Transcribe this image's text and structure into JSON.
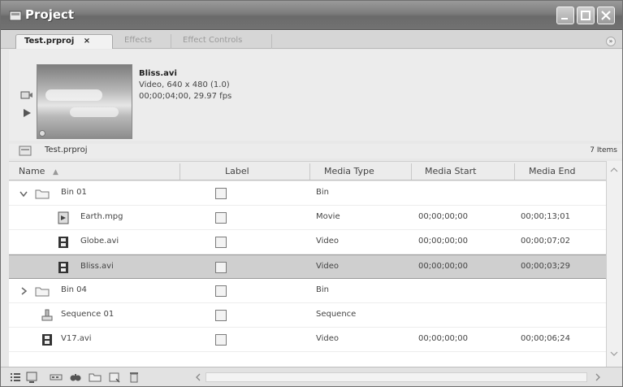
{
  "window": {
    "title": "Project"
  },
  "tabs": [
    {
      "label": "Test.prproj",
      "close": "×",
      "active": true
    },
    {
      "label": "Effects",
      "active": false
    },
    {
      "label": "Effect Controls",
      "active": false
    }
  ],
  "preview": {
    "clip_name": "Bliss.avi",
    "info_line1": "Video, 640 x 480 (1.0)",
    "info_line2": "00;00;04;00, 29.97 fps"
  },
  "project": {
    "name": "Test.prproj",
    "item_count": "7 Items"
  },
  "columns": {
    "name": "Name",
    "label": "Label",
    "media_type": "Media Type",
    "media_start": "Media Start",
    "media_end": "Media End"
  },
  "rows": [
    {
      "name": "Bin 01",
      "media_type": "Bin",
      "media_start": "",
      "media_end": "",
      "icon": "folder-icon",
      "expanded": true
    },
    {
      "name": "Earth.mpg",
      "media_type": "Movie",
      "media_start": "00;00;00;00",
      "media_end": "00;00;13;01",
      "icon": "movie-icon"
    },
    {
      "name": "Globe.avi",
      "media_type": "Video",
      "media_start": "00;00;00;00",
      "media_end": "00;00;07;02",
      "icon": "film-icon"
    },
    {
      "name": "Bliss.avi",
      "media_type": "Video",
      "media_start": "00;00;00;00",
      "media_end": "00;00;03;29",
      "icon": "film-icon",
      "selected": true
    },
    {
      "name": "Bin 04",
      "media_type": "Bin",
      "media_start": "",
      "media_end": "",
      "icon": "folder-icon",
      "expanded": false
    },
    {
      "name": "Sequence 01",
      "media_type": "Sequence",
      "media_start": "",
      "media_end": "",
      "icon": "sequence-icon"
    },
    {
      "name": "V17.avi",
      "media_type": "Video",
      "media_start": "00;00;00;00",
      "media_end": "00;00;06;24",
      "icon": "film-icon"
    }
  ],
  "colors": {
    "titlebar": "#7c7c7c",
    "selection": "#cfcfcf"
  },
  "toolbar_icons": [
    "list-view-icon",
    "icon-view-icon",
    "automate-to-sequence-icon",
    "find-icon",
    "new-bin-icon",
    "new-item-icon",
    "clear-icon"
  ]
}
